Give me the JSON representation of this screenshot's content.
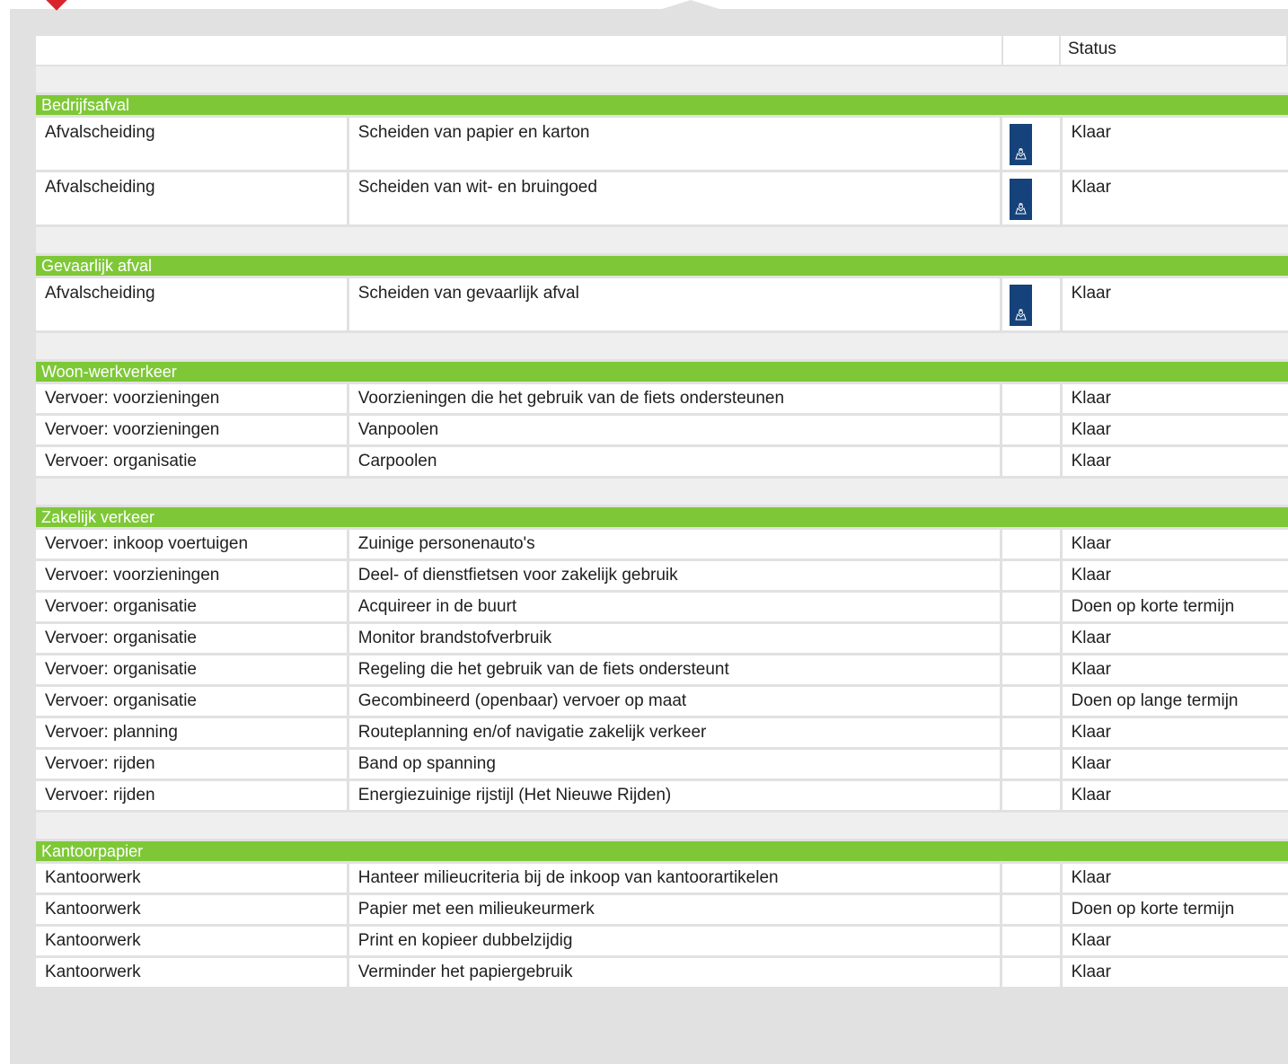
{
  "table": {
    "header": {
      "col1": "",
      "col2": "",
      "col3": "",
      "status": "Status"
    },
    "groups": [
      {
        "title": "Bedrijfsafval",
        "rows": [
          {
            "category": "Afvalscheiding",
            "measure": "Scheiden van papier en karton",
            "logo": "rijksoverheid-logo",
            "status": "Klaar"
          },
          {
            "category": "Afvalscheiding",
            "measure": "Scheiden van wit- en bruingoed",
            "logo": "rijksoverheid-logo",
            "status": "Klaar"
          }
        ]
      },
      {
        "title": "Gevaarlijk afval",
        "rows": [
          {
            "category": "Afvalscheiding",
            "measure": "Scheiden van gevaarlijk afval",
            "logo": "rijksoverheid-logo",
            "status": "Klaar"
          }
        ]
      },
      {
        "title": "Woon-werkverkeer",
        "rows": [
          {
            "category": "Vervoer: voorzieningen",
            "measure": "Voorzieningen die het gebruik van de fiets ondersteunen",
            "status": "Klaar"
          },
          {
            "category": "Vervoer: voorzieningen",
            "measure": "Vanpoolen",
            "status": "Klaar"
          },
          {
            "category": "Vervoer: organisatie",
            "measure": "Carpoolen",
            "status": "Klaar"
          }
        ]
      },
      {
        "title": "Zakelijk verkeer",
        "rows": [
          {
            "category": "Vervoer: inkoop voertuigen",
            "measure": "Zuinige personenauto's",
            "status": "Klaar"
          },
          {
            "category": "Vervoer: voorzieningen",
            "measure": "Deel- of dienstfietsen voor zakelijk gebruik",
            "status": "Klaar"
          },
          {
            "category": "Vervoer: organisatie",
            "measure": "Acquireer in de buurt",
            "status": "Doen op korte termijn"
          },
          {
            "category": "Vervoer: organisatie",
            "measure": "Monitor brandstofverbruik",
            "status": "Klaar"
          },
          {
            "category": "Vervoer: organisatie",
            "measure": "Regeling die het gebruik van de fiets ondersteunt",
            "status": "Klaar"
          },
          {
            "category": "Vervoer: organisatie",
            "measure": "Gecombineerd (openbaar) vervoer op maat",
            "status": "Doen op lange termijn"
          },
          {
            "category": "Vervoer: planning",
            "measure": "Routeplanning en/of navigatie zakelijk verkeer",
            "status": "Klaar"
          },
          {
            "category": "Vervoer: rijden",
            "measure": "Band op spanning",
            "status": "Klaar"
          },
          {
            "category": "Vervoer: rijden",
            "measure": "Energiezuinige rijstijl (Het Nieuwe Rijden)",
            "status": "Klaar"
          }
        ]
      },
      {
        "title": "Kantoorpapier",
        "rows": [
          {
            "category": "Kantoorwerk",
            "measure": "Hanteer milieucriteria bij de inkoop van kantoorartikelen",
            "status": "Klaar"
          },
          {
            "category": "Kantoorwerk",
            "measure": "Papier met een milieukeurmerk",
            "status": "Doen op korte termijn"
          },
          {
            "category": "Kantoorwerk",
            "measure": "Print en kopieer dubbelzijdig",
            "status": "Klaar"
          },
          {
            "category": "Kantoorwerk",
            "measure": "Verminder het papiergebruik",
            "status": "Klaar"
          }
        ]
      }
    ]
  },
  "colors": {
    "accent_green": "#7ec837",
    "panel_gray": "#e1e1e1",
    "logo_blue": "#15427a",
    "marker_red": "#d9242b"
  }
}
